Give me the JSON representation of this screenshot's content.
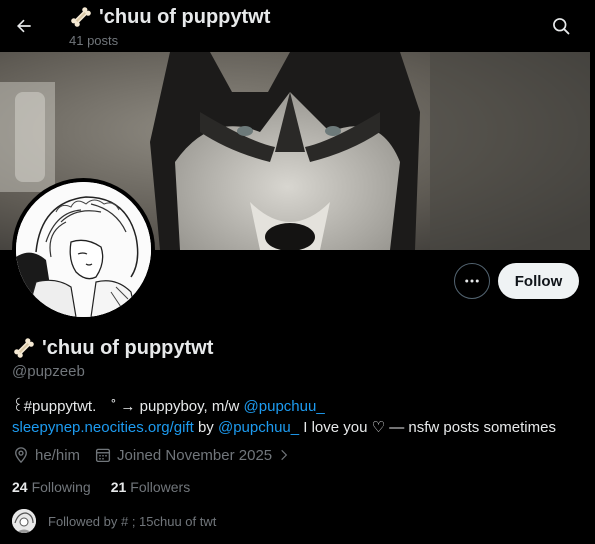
{
  "header": {
    "title": "'chuu of puppytwt",
    "title_emoji": "bone-emoji",
    "post_count": "41 posts",
    "back_icon": "arrow-left-icon",
    "search_icon": "search-icon"
  },
  "profile": {
    "display_name": "'chuu of puppytwt",
    "handle": "@pupzeeb",
    "follow_label": "Follow",
    "more_icon": "more-icon",
    "bio": {
      "line1_text": "꒰#puppytwt.　˚ → puppyboy, m/w ",
      "line1_mention": "@pupchuu_",
      "line2_link": "sleepynep.neocities.org/gift",
      "line2_by": " by ",
      "line2_mention": "@pupchuu_",
      "line2_rest": " I love you ♡ — nsfw posts sometimes"
    },
    "pronouns": "he/him",
    "joined": "Joined November 2025",
    "following_count": "24",
    "following_label": "Following",
    "followers_count": "21",
    "followers_label": "Followers",
    "followed_by": "Followed by # ; 15chuu of twt"
  },
  "colors": {
    "background": "#000000",
    "text": "#e7e9ea",
    "secondary": "#71767b",
    "link": "#1d9bf0",
    "follow_bg": "#eff3f4"
  }
}
